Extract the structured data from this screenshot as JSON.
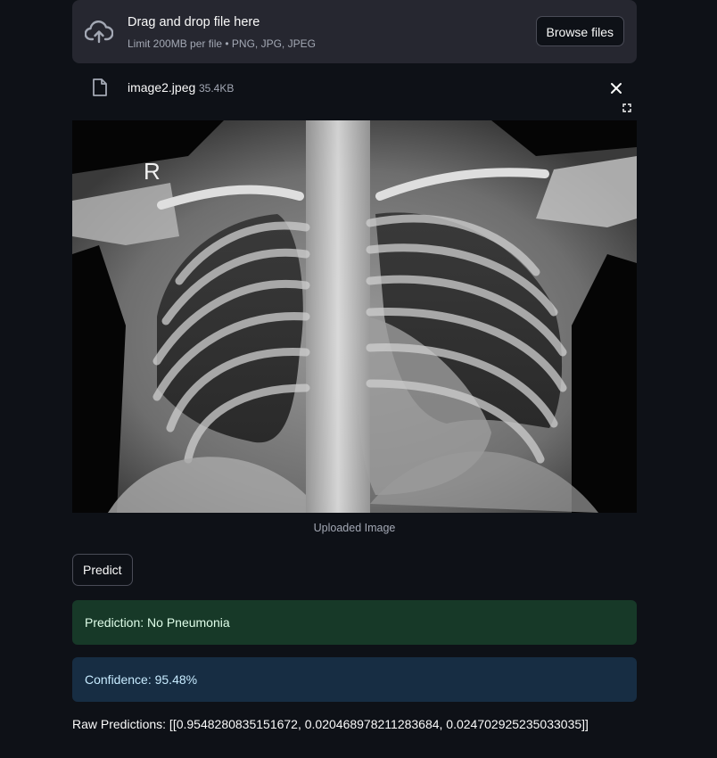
{
  "uploader": {
    "title": "Drag and drop file here",
    "subtitle": "Limit 200MB per file • PNG, JPG, JPEG",
    "browse_label": "Browse files",
    "upload_icon": "cloud-upload-icon"
  },
  "file": {
    "name": "image2.jpeg",
    "size": "35.4KB",
    "icon": "file-icon",
    "remove_icon": "close-icon",
    "fullscreen_icon": "fullscreen-icon"
  },
  "image": {
    "marker": "R",
    "caption": "Uploaded Image"
  },
  "actions": {
    "predict_label": "Predict"
  },
  "results": {
    "prediction": "Prediction: No Pneumonia",
    "confidence": "Confidence: 95.48%",
    "raw": "Raw Predictions: [[0.9548280835151672, 0.020468978211283684, 0.024702925235033035]]"
  },
  "colors": {
    "background": "#0e1117",
    "dropzone": "#262730",
    "success_bg": "#173928",
    "info_bg": "#172d43"
  }
}
